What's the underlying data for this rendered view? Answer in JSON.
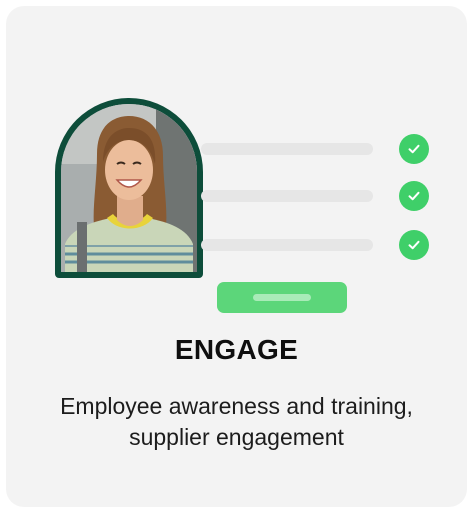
{
  "card": {
    "title": "ENGAGE",
    "description": "Employee awareness and training, supplier engagement"
  },
  "checklist": {
    "items_checked": [
      true,
      true,
      true
    ]
  },
  "colors": {
    "card_background": "#f3f3f3",
    "avatar_border": "#0d4d3a",
    "check_green": "#3fcf69",
    "button_green": "#5cd67a",
    "placeholder_bar": "#e6e6e6"
  },
  "icons": {
    "check": "check-icon",
    "avatar": "avatar-photo"
  }
}
